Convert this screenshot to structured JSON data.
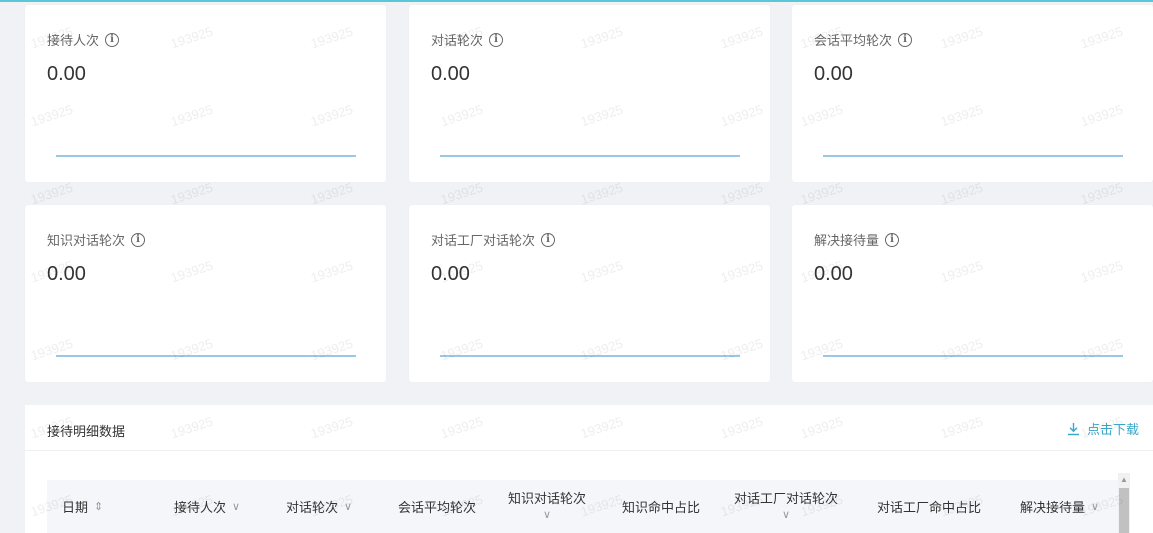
{
  "metrics": [
    {
      "label": "接待人次",
      "value": "0.00"
    },
    {
      "label": "对话轮次",
      "value": "0.00"
    },
    {
      "label": "会话平均轮次",
      "value": "0.00"
    },
    {
      "label": "知识对话轮次",
      "value": "0.00"
    },
    {
      "label": "对话工厂对话轮次",
      "value": "0.00"
    },
    {
      "label": "解决接待量",
      "value": "0.00"
    }
  ],
  "detail": {
    "title": "接待明细数据",
    "download_label": "点击下载",
    "columns": [
      {
        "label": "日期",
        "icon": "sort-icon"
      },
      {
        "label": "接待人次",
        "icon": "chevron-down-icon"
      },
      {
        "label": "对话轮次",
        "icon": "chevron-down-icon"
      },
      {
        "label": "会话平均轮次"
      },
      {
        "label": "知识对话轮次",
        "icon": "chevron-down-icon"
      },
      {
        "label": "知识命中占比"
      },
      {
        "label": "对话工厂对话轮次",
        "icon": "chevron-down-icon"
      },
      {
        "label": "对话工厂命中占比"
      },
      {
        "label": "解决接待量",
        "icon": "chevron-down-icon"
      }
    ]
  },
  "watermark": "193925",
  "colors": {
    "accent": "#3aa8c8",
    "sparkline": "#5ba8d6",
    "topbar": "#5cc7d6"
  }
}
